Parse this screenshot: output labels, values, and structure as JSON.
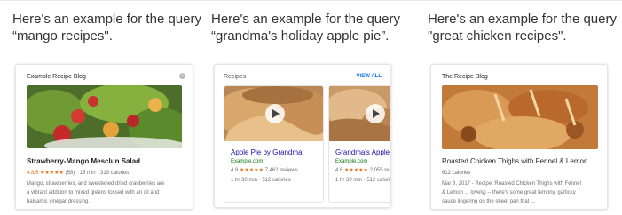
{
  "examples": [
    {
      "caption_line1": "Here's an example for the query",
      "caption_line2": "“mango recipes\".",
      "card": {
        "header": "Example Recipe Blog",
        "title": "Strawberry-Mango Mesclun Salad",
        "rating_value": "4.8/5",
        "stars": "★★★★★",
        "meta": "(58) · 15 min · 319 calories",
        "desc_line1": "Mango, strawberries, and sweetened dried cranberries are",
        "desc_line2": "a vibrant addition to mixed greens tossed with an oil and",
        "desc_line3": "balsamic vinegar dressing."
      }
    },
    {
      "caption_line1": "Here's an example for the query",
      "caption_line2": "“grandma's holiday apple pie”.",
      "card": {
        "header": "Recipes",
        "view_all": "VIEW ALL",
        "items": [
          {
            "title": "Apple Pie by Grandma",
            "site": "Example.com",
            "rating": "4.8",
            "stars": "★★★★★",
            "reviews": "7,462 reviews",
            "meta": "1 hr 30 min · 512 calories"
          },
          {
            "title": "Grandma's Apple P",
            "site": "Example.com",
            "rating": "4.6",
            "stars": "★★★★★",
            "reviews": "2,055 re",
            "meta": "1 hr 30 min · 512 calories"
          }
        ]
      }
    },
    {
      "caption_line1": "Here's an example for the query",
      "caption_line2": "\"great chicken recipes\".",
      "card": {
        "header": "The Recipe Blog",
        "title": "Roasted Chicken Thighs with Fennel & Lemon",
        "calories": "612 calories",
        "desc_line1": "Mar 8, 2017 - Recipe: Roasted Chicken Thighs with Fennel",
        "desc_line2": "& Lemon ... lovely) -- there's some great lemony, garlicky",
        "desc_line3": "sauce lingering on the sheet pan that ..."
      }
    }
  ]
}
